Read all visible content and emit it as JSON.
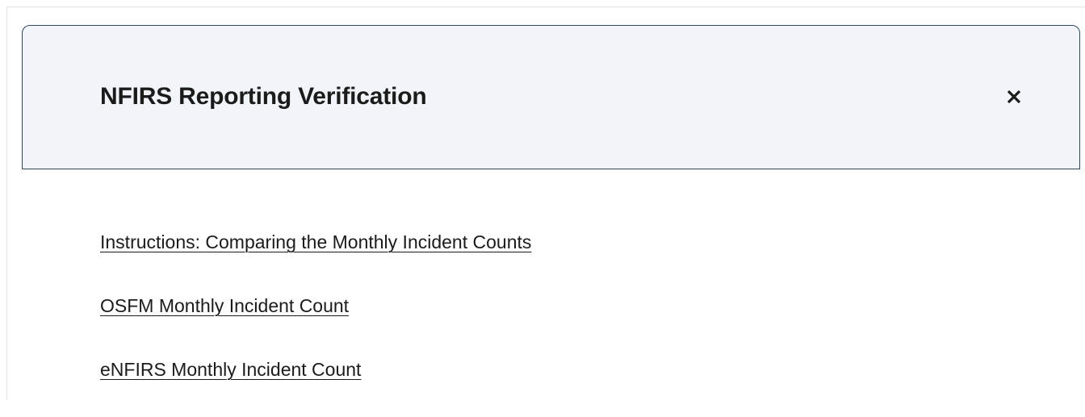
{
  "accordion": {
    "title": "NFIRS Reporting Verification",
    "close_icon": "close-icon",
    "links": [
      {
        "label": "Instructions: Comparing the Monthly Incident Counts"
      },
      {
        "label": "OSFM Monthly Incident Count"
      },
      {
        "label": "eNFIRS Monthly Incident Count"
      }
    ]
  },
  "colors": {
    "header_background": "#f1f4f8",
    "header_border": "#2f4761",
    "text": "#1b1b1b"
  }
}
